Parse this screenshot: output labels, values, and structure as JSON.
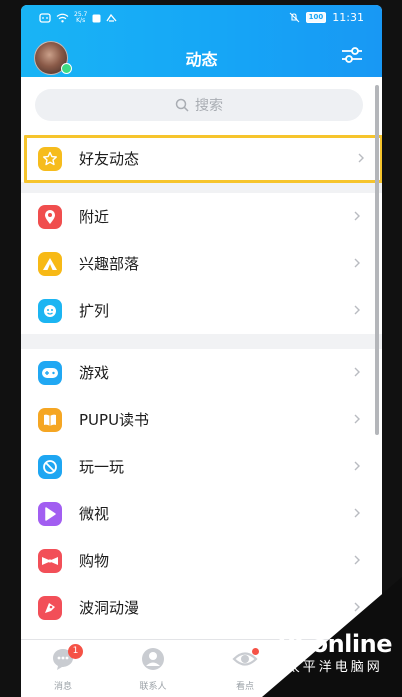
{
  "status_bar": {
    "net_speed_value": "25.7",
    "net_speed_unit": "K/s",
    "battery": "100",
    "time": "11:31"
  },
  "header": {
    "title": "动态"
  },
  "search": {
    "placeholder": "搜索"
  },
  "highlighted_item": {
    "label": "好友动态",
    "icon": "star-icon",
    "color": "#f6bc1d"
  },
  "groups": [
    {
      "items": [
        {
          "label": "附近",
          "icon": "location-pin-icon",
          "color": "#f04e4e"
        },
        {
          "label": "兴趣部落",
          "icon": "tent-icon",
          "color": "#f7b916"
        },
        {
          "label": "扩列",
          "icon": "chat-face-icon",
          "color": "#1cb5f2"
        }
      ]
    },
    {
      "items": [
        {
          "label": "游戏",
          "icon": "gamepad-icon",
          "color": "#21a8f3"
        },
        {
          "label": "PUPU读书",
          "icon": "book-icon",
          "color": "#f5a623"
        },
        {
          "label": "玩一玩",
          "icon": "play-circle-icon",
          "color": "#1ea6f2"
        },
        {
          "label": "微视",
          "icon": "video-icon",
          "color": "#a25ef1"
        },
        {
          "label": "购物",
          "icon": "bowtie-icon",
          "color": "#f24f58"
        },
        {
          "label": "波洞动漫",
          "icon": "comic-icon",
          "color": "#f24f58"
        }
      ]
    }
  ],
  "tabbar": {
    "tabs": [
      {
        "label": "消息",
        "icon": "message-icon",
        "badge": "1"
      },
      {
        "label": "联系人",
        "icon": "contacts-icon"
      },
      {
        "label": "看点",
        "icon": "eye-icon"
      }
    ]
  },
  "watermark": {
    "main": "PConline",
    "sub": "太平洋电脑网"
  }
}
